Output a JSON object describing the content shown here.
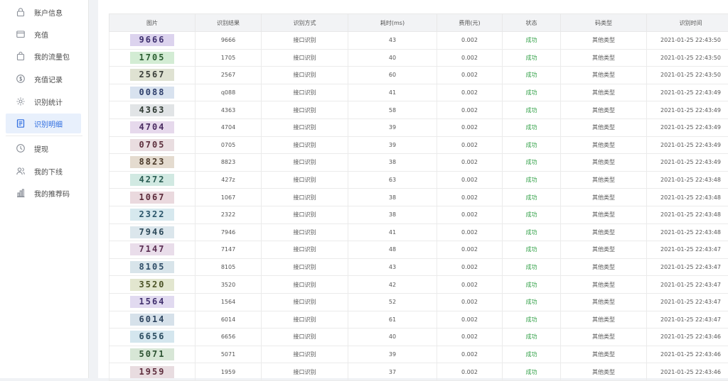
{
  "sidebar": {
    "items": [
      {
        "label": "账户信息",
        "icon": "lock-icon"
      },
      {
        "label": "充值",
        "icon": "wallet-icon"
      },
      {
        "label": "我的流量包",
        "icon": "bag-icon"
      },
      {
        "label": "充值记录",
        "icon": "money-circle-icon"
      },
      {
        "label": "识别统计",
        "icon": "gear-icon"
      },
      {
        "label": "识别明细",
        "icon": "document-icon",
        "active": true
      },
      {
        "label": "提现",
        "icon": "clock-icon"
      },
      {
        "label": "我的下线",
        "icon": "users-icon"
      },
      {
        "label": "我的推荐码",
        "icon": "chart-icon"
      }
    ],
    "active_color": "#2d6cdf"
  },
  "table": {
    "headers": [
      "图片",
      "识别结果",
      "识别方式",
      "耗时(ms)",
      "费用(元)",
      "状态",
      "码类型",
      "识别时间"
    ],
    "rows": [
      {
        "captcha": "9666",
        "result": "9666",
        "method": "接口识别",
        "time": "43",
        "cost": "0.002",
        "status": "成功",
        "type": "其他类型",
        "datetime": "2021-01-25 22:43:50"
      },
      {
        "captcha": "1705",
        "result": "1705",
        "method": "接口识别",
        "time": "40",
        "cost": "0.002",
        "status": "成功",
        "type": "其他类型",
        "datetime": "2021-01-25 22:43:50"
      },
      {
        "captcha": "2567",
        "result": "2567",
        "method": "接口识别",
        "time": "60",
        "cost": "0.002",
        "status": "成功",
        "type": "其他类型",
        "datetime": "2021-01-25 22:43:50"
      },
      {
        "captcha": "0088",
        "result": "q088",
        "method": "接口识别",
        "time": "41",
        "cost": "0.002",
        "status": "成功",
        "type": "其他类型",
        "datetime": "2021-01-25 22:43:49"
      },
      {
        "captcha": "4363",
        "result": "4363",
        "method": "接口识别",
        "time": "58",
        "cost": "0.002",
        "status": "成功",
        "type": "其他类型",
        "datetime": "2021-01-25 22:43:49"
      },
      {
        "captcha": "4704",
        "result": "4704",
        "method": "接口识别",
        "time": "39",
        "cost": "0.002",
        "status": "成功",
        "type": "其他类型",
        "datetime": "2021-01-25 22:43:49"
      },
      {
        "captcha": "0705",
        "result": "0705",
        "method": "接口识别",
        "time": "39",
        "cost": "0.002",
        "status": "成功",
        "type": "其他类型",
        "datetime": "2021-01-25 22:43:49"
      },
      {
        "captcha": "8823",
        "result": "8823",
        "method": "接口识别",
        "time": "38",
        "cost": "0.002",
        "status": "成功",
        "type": "其他类型",
        "datetime": "2021-01-25 22:43:49"
      },
      {
        "captcha": "4272",
        "result": "427z",
        "method": "接口识别",
        "time": "63",
        "cost": "0.002",
        "status": "成功",
        "type": "其他类型",
        "datetime": "2021-01-25 22:43:48"
      },
      {
        "captcha": "1067",
        "result": "1067",
        "method": "接口识别",
        "time": "38",
        "cost": "0.002",
        "status": "成功",
        "type": "其他类型",
        "datetime": "2021-01-25 22:43:48"
      },
      {
        "captcha": "2322",
        "result": "2322",
        "method": "接口识别",
        "time": "38",
        "cost": "0.002",
        "status": "成功",
        "type": "其他类型",
        "datetime": "2021-01-25 22:43:48"
      },
      {
        "captcha": "7946",
        "result": "7946",
        "method": "接口识别",
        "time": "41",
        "cost": "0.002",
        "status": "成功",
        "type": "其他类型",
        "datetime": "2021-01-25 22:43:48"
      },
      {
        "captcha": "7147",
        "result": "7147",
        "method": "接口识别",
        "time": "48",
        "cost": "0.002",
        "status": "成功",
        "type": "其他类型",
        "datetime": "2021-01-25 22:43:47"
      },
      {
        "captcha": "8105",
        "result": "8105",
        "method": "接口识别",
        "time": "43",
        "cost": "0.002",
        "status": "成功",
        "type": "其他类型",
        "datetime": "2021-01-25 22:43:47"
      },
      {
        "captcha": "3520",
        "result": "3520",
        "method": "接口识别",
        "time": "42",
        "cost": "0.002",
        "status": "成功",
        "type": "其他类型",
        "datetime": "2021-01-25 22:43:47"
      },
      {
        "captcha": "1564",
        "result": "1564",
        "method": "接口识别",
        "time": "52",
        "cost": "0.002",
        "status": "成功",
        "type": "其他类型",
        "datetime": "2021-01-25 22:43:47"
      },
      {
        "captcha": "6014",
        "result": "6014",
        "method": "接口识别",
        "time": "61",
        "cost": "0.002",
        "status": "成功",
        "type": "其他类型",
        "datetime": "2021-01-25 22:43:47"
      },
      {
        "captcha": "6656",
        "result": "6656",
        "method": "接口识别",
        "time": "40",
        "cost": "0.002",
        "status": "成功",
        "type": "其他类型",
        "datetime": "2021-01-25 22:43:46"
      },
      {
        "captcha": "5071",
        "result": "5071",
        "method": "接口识别",
        "time": "39",
        "cost": "0.002",
        "status": "成功",
        "type": "其他类型",
        "datetime": "2021-01-25 22:43:46"
      },
      {
        "captcha": "1959",
        "result": "1959",
        "method": "接口识别",
        "time": "37",
        "cost": "0.002",
        "status": "成功",
        "type": "其他类型",
        "datetime": "2021-01-25 22:43:46"
      }
    ]
  },
  "colors": {
    "success": "#35a24a",
    "header_bg": "#f2f3f5",
    "captcha_backgrounds": [
      "#dcd3ee",
      "#d3ecd4",
      "#dfe2d2",
      "#d8e2ef",
      "#e1e4e6",
      "#e6d9ec",
      "#e9dde0",
      "#e4dbcf",
      "#d1e9e2",
      "#ead9de",
      "#d6e8ee",
      "#dbe6ec",
      "#e9ddea",
      "#d8e4ea",
      "#e2e6cf",
      "#e1daf0",
      "#d6e1ea",
      "#d4e6ee",
      "#d7e6d6",
      "#e8dce0"
    ],
    "captcha_text": [
      "#3d2f6e",
      "#2b5e31",
      "#3b3f3a",
      "#2e3f6b",
      "#2f3a33",
      "#4a2c61",
      "#5d2f3d",
      "#4b3a2a",
      "#2a5d53",
      "#5b2a3a",
      "#2a556a",
      "#2d4a5a",
      "#5a2e52",
      "#2f4d67",
      "#4c5327",
      "#41306e",
      "#2e4560",
      "#2b4d60",
      "#2c5131",
      "#5e2e3e"
    ]
  }
}
